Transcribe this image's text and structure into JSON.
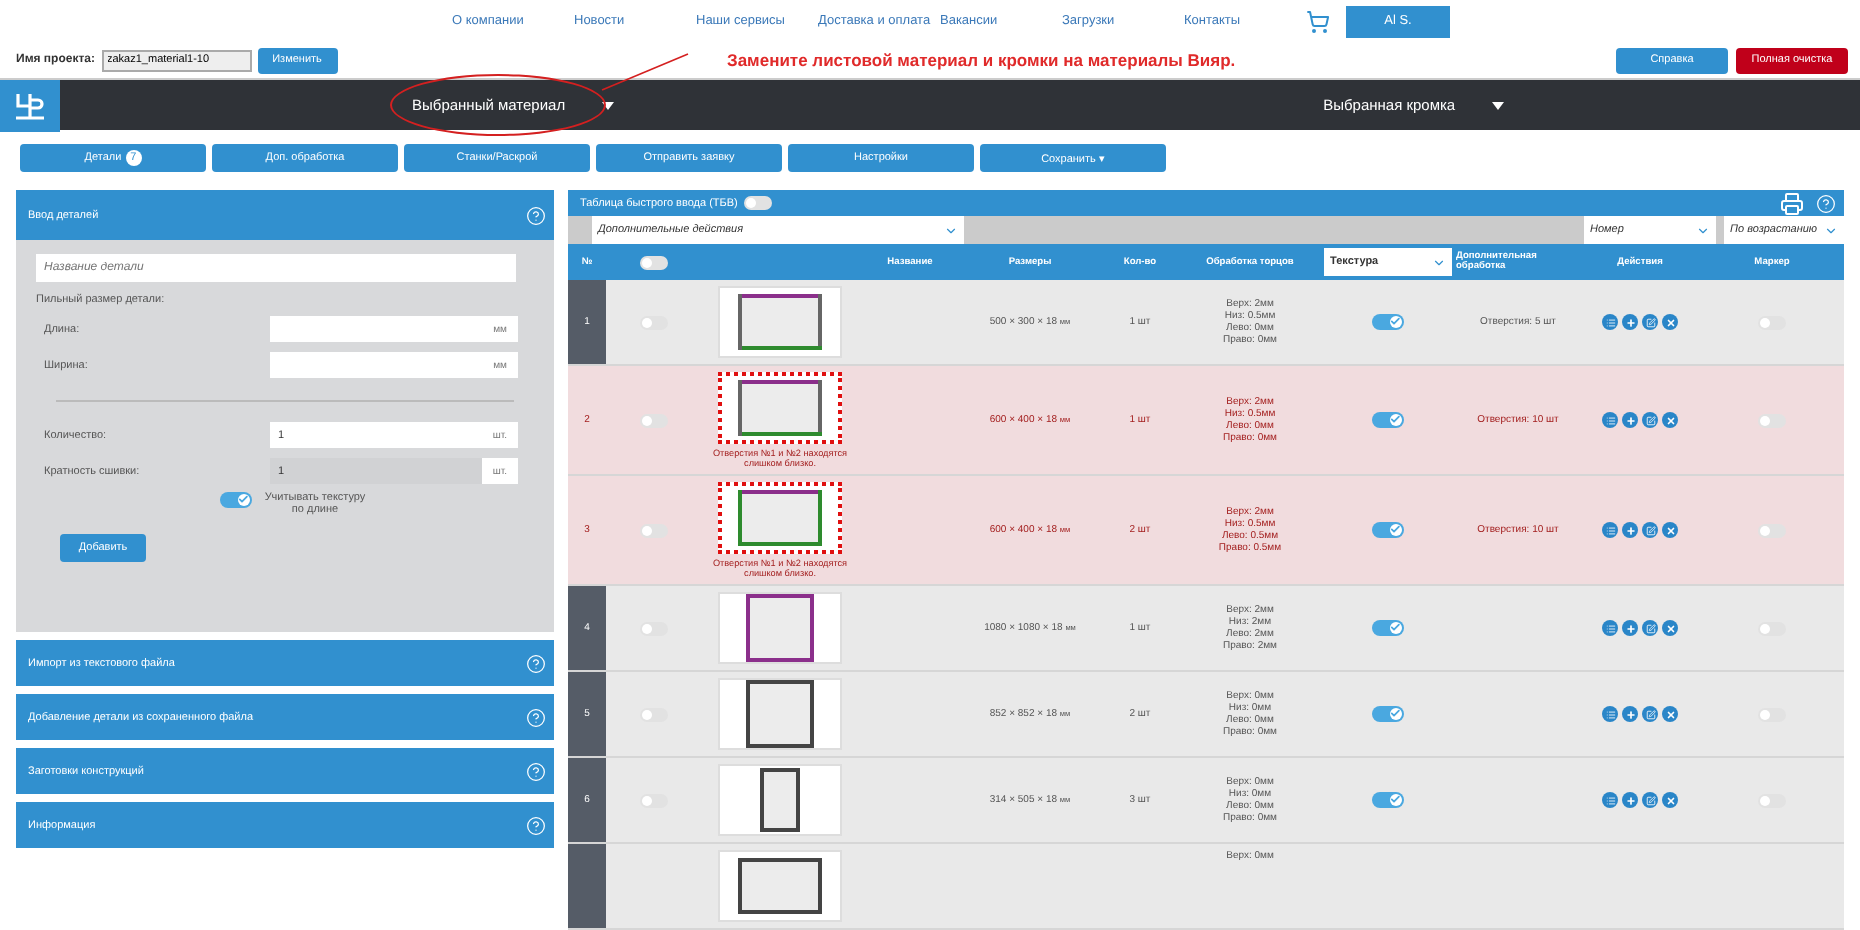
{
  "nav": {
    "links": [
      "О компании",
      "Новости",
      "Наши сервисы",
      "Доставка и оплата",
      "Вакансии",
      "Загрузки",
      "Контакты"
    ],
    "user": "Al S."
  },
  "project": {
    "label": "Имя проекта:",
    "value": "zakaz1_material1-10",
    "button": "Изменить"
  },
  "notice": "Замените листовой материал и кромки на материалы Вияр.",
  "top_buttons": [
    {
      "label": "Справка",
      "kind": "info"
    },
    {
      "label": "Полная очистка",
      "kind": "danger"
    }
  ],
  "material_bar": {
    "material": "Выбранный материал",
    "edge": "Выбранная кромка"
  },
  "tabs": [
    {
      "label": "Детали",
      "badge": "7"
    },
    {
      "label": "Доп. обработка"
    },
    {
      "label": "Станки/Раскрой"
    },
    {
      "label": "Отправить заявку"
    },
    {
      "label": "Настройки"
    },
    {
      "label": "Сохранить ▾"
    }
  ],
  "entry": {
    "title": "Ввод деталей",
    "name_placeholder": "Название детали",
    "size_label": "Пильный размер детали:",
    "size_fields": [
      {
        "label": "Длина:",
        "unit": "мм",
        "disabled": false
      },
      {
        "label": "Ширина:",
        "unit": "мм",
        "disabled": false
      }
    ],
    "count_fields": [
      {
        "label": "Количество:",
        "value": "1",
        "unit": "шт.",
        "disabled": false
      },
      {
        "label": "Кратность сшивки:",
        "value": "1",
        "unit": "шт.",
        "disabled": true
      }
    ],
    "texture": {
      "label": "Учитывать текстуру по длине",
      "on": true
    },
    "button": "Добавить"
  },
  "sections": [
    "Импорт из текстового файла",
    "Добавление детали из сохраненного файла",
    "Заготовки конструкций",
    "Информация"
  ],
  "table": {
    "title": "Таблица быстрого ввода (ТБВ)",
    "fast_input_on": false,
    "actions_select": "Дополнительные действия",
    "sort_field": "Номер",
    "sort_order": "По возрастанию",
    "columns": [
      {
        "kind": "text",
        "label": "№"
      },
      {
        "kind": "toggle",
        "on": false
      },
      {
        "kind": "blank"
      },
      {
        "kind": "text",
        "label": "Название"
      },
      {
        "kind": "text",
        "label": "Размеры"
      },
      {
        "kind": "text",
        "label": "Кол-во"
      },
      {
        "kind": "text",
        "label": "Обработка торцов"
      },
      {
        "kind": "select",
        "label": "Текстура"
      },
      {
        "kind": "text",
        "label": "Дополнительная обработка"
      },
      {
        "kind": "text",
        "label": "Действия"
      },
      {
        "kind": "text",
        "label": "Маркер"
      }
    ],
    "rows": [
      {
        "number": "1",
        "selected": false,
        "error": false,
        "thumbnail": {
          "kind": "wide",
          "edges": [
            {
              "color": "#8b2f8b"
            },
            {
              "color": "#666666"
            },
            {
              "color": "#2e8b2e"
            },
            {
              "color": "#666666"
            }
          ]
        },
        "size": "500 × 300 × 18",
        "unit": "мм",
        "qty": "1 шт",
        "edging": [
          "Верх: 2мм",
          "Низ: 0.5мм",
          "Лево: 0мм",
          "Право: 0мм"
        ],
        "texture": true,
        "extra": "Отверстия: 5 шт",
        "marker": false
      },
      {
        "number": "2",
        "selected": false,
        "error": true,
        "warning": "Отверстия №1 и №2 находятся слишком близко.",
        "thumbnail": {
          "kind": "wide",
          "edges": [
            {
              "color": "#8b2f8b"
            },
            {
              "color": "#666666"
            },
            {
              "color": "#2e8b2e"
            },
            {
              "color": "#666666"
            }
          ]
        },
        "size": "600 × 400 × 18",
        "unit": "мм",
        "qty": "1 шт",
        "edging": [
          "Верх: 2мм",
          "Низ: 0.5мм",
          "Лево: 0мм",
          "Право: 0мм"
        ],
        "texture": true,
        "extra": "Отверстия: 10 шт",
        "marker": false
      },
      {
        "number": "3",
        "selected": false,
        "error": true,
        "warning": "Отверстия №1 и №2 находятся слишком близко.",
        "thumbnail": {
          "kind": "wide",
          "edges": [
            {
              "color": "#8b2f8b"
            },
            {
              "color": "#2e8b2e"
            },
            {
              "color": "#2e8b2e"
            },
            {
              "color": "#2e8b2e"
            }
          ]
        },
        "size": "600 × 400 × 18",
        "unit": "мм",
        "qty": "2 шт",
        "edging": [
          "Верх: 2мм",
          "Низ: 0.5мм",
          "Лево: 0.5мм",
          "Право: 0.5мм"
        ],
        "texture": true,
        "extra": "Отверстия: 10 шт",
        "marker": false
      },
      {
        "number": "4",
        "selected": false,
        "error": false,
        "thumbnail": {
          "kind": "square",
          "edges": [
            {
              "color": "#8b2f8b"
            },
            {
              "color": "#8b2f8b"
            },
            {
              "color": "#8b2f8b"
            },
            {
              "color": "#8b2f8b"
            }
          ]
        },
        "size": "1080 × 1080 × 18",
        "unit": "мм",
        "qty": "1 шт",
        "edging": [
          "Верх: 2мм",
          "Низ: 2мм",
          "Лево: 2мм",
          "Право: 2мм"
        ],
        "texture": true,
        "marker": false
      },
      {
        "number": "5",
        "selected": false,
        "error": false,
        "thumbnail": {
          "kind": "square",
          "edges": [
            {
              "color": "#444444"
            },
            {
              "color": "#444444"
            },
            {
              "color": "#444444"
            },
            {
              "color": "#444444"
            }
          ]
        },
        "size": "852 × 852 × 18",
        "unit": "мм",
        "qty": "2 шт",
        "edging": [
          "Верх: 0мм",
          "Низ: 0мм",
          "Лево: 0мм",
          "Право: 0мм"
        ],
        "texture": true,
        "marker": false
      },
      {
        "number": "6",
        "selected": false,
        "error": false,
        "thumbnail": {
          "kind": "tall",
          "edges": [
            {
              "color": "#444444"
            },
            {
              "color": "#444444"
            },
            {
              "color": "#444444"
            },
            {
              "color": "#444444"
            }
          ]
        },
        "size": "314 × 505 × 18",
        "unit": "мм",
        "qty": "3 шт",
        "edging": [
          "Верх: 0мм",
          "Низ: 0мм",
          "Лево: 0мм",
          "Право: 0мм"
        ],
        "texture": true,
        "marker": false
      },
      {
        "error": false,
        "thumbnail": {
          "kind": "wide",
          "edges": [
            {
              "color": "#444444"
            },
            {
              "color": "#444444"
            },
            {
              "color": "#444444"
            },
            {
              "color": "#444444"
            }
          ]
        },
        "edging": [
          "Верх: 0мм"
        ]
      }
    ]
  }
}
